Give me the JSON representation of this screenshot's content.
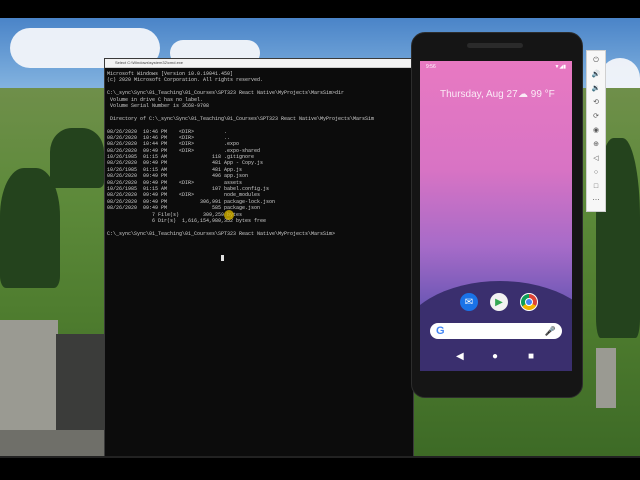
{
  "terminal": {
    "title": "Select C:\\Windows\\system32\\cmd.exe",
    "lines": [
      "Microsoft Windows [Version 10.0.19041.450]",
      "(c) 2020 Microsoft Corporation. All rights reserved.",
      "",
      "C:\\_sync\\Sync\\01_Teaching\\01_Courses\\SPT323 React Native\\MyProjects\\MarsSim>dir",
      " Volume in drive C has no label.",
      " Volume Serial Number is 3C68-9708",
      "",
      " Directory of C:\\_sync\\Sync\\01_Teaching\\01_Courses\\SPT323 React Native\\MyProjects\\MarsSim",
      "",
      "08/26/2020  10:46 PM    <DIR>          .",
      "08/26/2020  10:46 PM    <DIR>          ..",
      "08/26/2020  10:44 PM    <DIR>          .expo",
      "08/26/2020  09:49 PM    <DIR>          .expo-shared",
      "10/26/1985  01:15 AM               118 .gitignore",
      "08/26/2020  09:49 PM               481 App - Copy.js",
      "10/26/1985  01:15 AM               481 App.js",
      "08/26/2020  09:49 PM               496 app.json",
      "08/26/2020  09:49 PM    <DIR>          assets",
      "10/26/1985  01:15 AM               107 babel.config.js",
      "08/26/2020  09:49 PM    <DIR>          node_modules",
      "08/26/2020  09:49 PM           306,991 package-lock.json",
      "08/26/2020  09:49 PM               585 package.json",
      "               7 File(s)        309,259 bytes",
      "               6 Dir(s)  1,616,154,980,352 bytes free",
      "",
      "C:\\_sync\\Sync\\01_Teaching\\01_Courses\\SPT323 React Native\\MyProjects\\MarsSim>"
    ]
  },
  "phone": {
    "status_time": "9:56",
    "status_icons": "▼◢▮",
    "date": "Thursday, Aug 27",
    "weather": "☁ 99 °F",
    "apps": [
      "Messages",
      "Play Store",
      "Chrome"
    ],
    "search_logo": "G",
    "mic_icon": "mic-icon",
    "nav": {
      "back": "◀",
      "home": "●",
      "recents": "■"
    }
  },
  "emulator_toolbar": {
    "tools": [
      {
        "icon": "power-icon",
        "glyph": "⏻"
      },
      {
        "icon": "volume-up-icon",
        "glyph": "🔊"
      },
      {
        "icon": "volume-down-icon",
        "glyph": "🔉"
      },
      {
        "icon": "rotate-left-icon",
        "glyph": "⟲"
      },
      {
        "icon": "rotate-right-icon",
        "glyph": "⟳"
      },
      {
        "icon": "camera-icon",
        "glyph": "◉"
      },
      {
        "icon": "zoom-icon",
        "glyph": "⊕"
      },
      {
        "icon": "back-icon",
        "glyph": "◁"
      },
      {
        "icon": "home-icon",
        "glyph": "○"
      },
      {
        "icon": "overview-icon",
        "glyph": "□"
      },
      {
        "icon": "more-icon",
        "glyph": "⋯"
      }
    ]
  }
}
